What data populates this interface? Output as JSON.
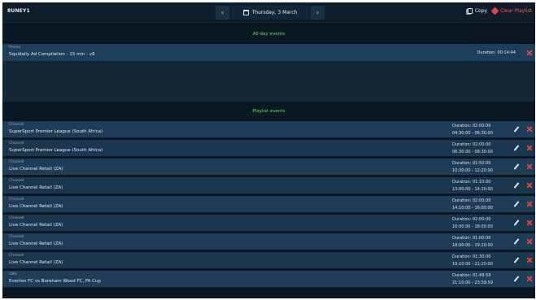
{
  "header": {
    "channel_name": "8UNEY1",
    "date": "Thursday, 3 March",
    "prev_symbol": "‹",
    "next_symbol": "›",
    "copy_label": "Copy",
    "clear_label": "Clear Playlist",
    "icons": {
      "calendar": "calendar-icon",
      "copy": "copy-icon",
      "clear": "clear-icon"
    },
    "colors": {
      "clear": "#e5413b",
      "accent_green": "#7cd96c"
    }
  },
  "all_day": {
    "heading": "All-day events",
    "events": [
      {
        "type": "Promo",
        "title": "Squidaily Ad Compilation - 15 min - v6",
        "duration": "Duration: 00:14:44"
      }
    ]
  },
  "playlist": {
    "heading": "Playlist events",
    "events": [
      {
        "type": "Channel",
        "title": "SuperSport Premier League (South Africa)",
        "duration": "Duration: 02:00:00",
        "time": "04:30:00 - 06:30:00"
      },
      {
        "type": "Channel",
        "title": "SuperSport Premier League (South Africa)",
        "duration": "Duration: 02:00:00",
        "time": "06:30:00 - 08:30:00"
      },
      {
        "type": "Channel",
        "title": "Live Channel Retail (ZA)",
        "duration": "Duration: 01:50:00",
        "time": "10:30:00 - 12:20:00"
      },
      {
        "type": "Channel",
        "title": "Live Channel Retail (ZA)",
        "duration": "Duration: 01:10:00",
        "time": "13:00:00 - 14:10:00"
      },
      {
        "type": "Channel",
        "title": "Live Channel Retail (ZA)",
        "duration": "Duration: 02:00:00",
        "time": "14:10:00 - 16:00:00"
      },
      {
        "type": "Channel",
        "title": "Live Channel Retail (ZA)",
        "duration": "Duration: 02:00:00",
        "time": "16:00:00 - 18:00:00"
      },
      {
        "type": "Channel",
        "title": "Live Channel Retail (ZA)",
        "duration": "Duration: 01:00:00",
        "time": "18:00:00 - 19:10:00"
      },
      {
        "type": "Channel",
        "title": "Live Channel Retail (ZA)",
        "duration": "Duration: 01:30:00",
        "time": "19:10:00 - 21:20:00"
      },
      {
        "type": "OBS",
        "title": "Everton FC vs Boreham Wood FC, FA Cup",
        "duration": "Duration: 01:49:59",
        "time": "21:10:00 - 23:59:59"
      }
    ]
  }
}
